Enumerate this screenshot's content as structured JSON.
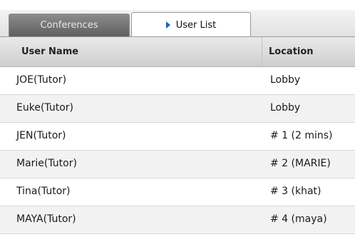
{
  "tabs": {
    "conferences": "Conferences",
    "user_list": "User List"
  },
  "table": {
    "columns": {
      "name": "User Name",
      "location": "Location"
    },
    "rows": [
      {
        "name": "JOE(Tutor)",
        "location": "Lobby"
      },
      {
        "name": "Euke(Tutor)",
        "location": "Lobby"
      },
      {
        "name": "JEN(Tutor)",
        "location": "# 1 (2 mins)"
      },
      {
        "name": "Marie(Tutor)",
        "location": "# 2 (MARIE)"
      },
      {
        "name": "Tina(Tutor)",
        "location": "# 3 (khat)"
      },
      {
        "name": "MAYA(Tutor)",
        "location": "# 4 (maya)"
      }
    ]
  }
}
